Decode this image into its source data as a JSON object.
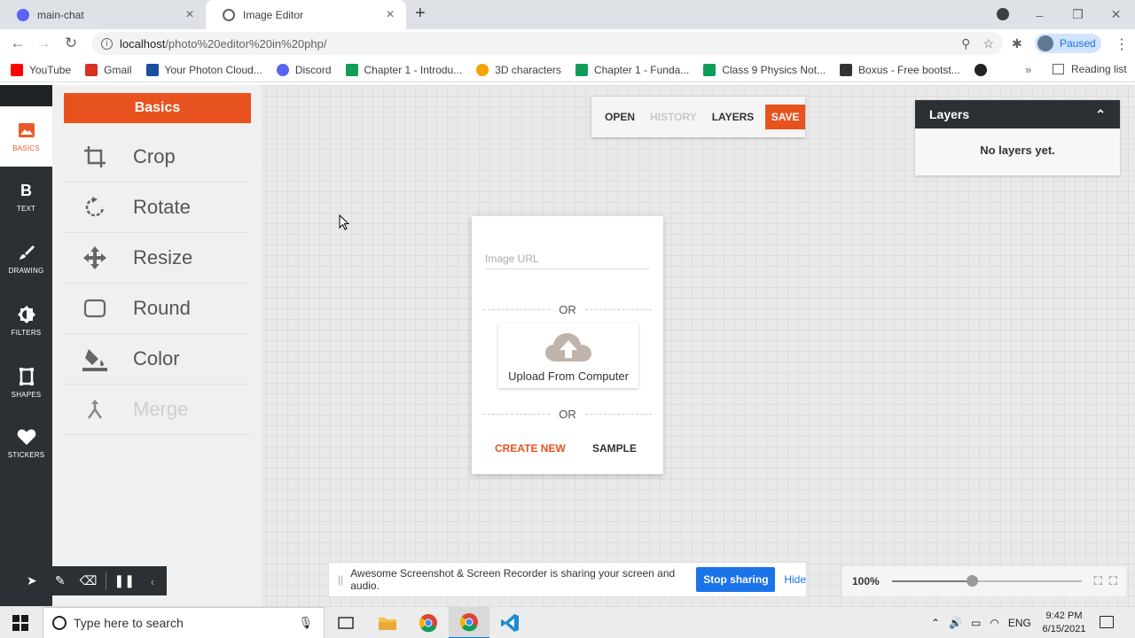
{
  "browser": {
    "tabs": [
      {
        "title": "main-chat",
        "favicon_color": "#5865f2"
      },
      {
        "title": "Image Editor",
        "favicon_color": "#5f6368"
      }
    ],
    "url_host": "localhost",
    "url_path": "/photo%20editor%20in%20php/",
    "profile_label": "Paused",
    "bookmarks": [
      {
        "label": "YouTube",
        "color": "#ff0000"
      },
      {
        "label": "Gmail",
        "color": "#d93025"
      },
      {
        "label": "Your Photon Cloud...",
        "color": "#1a4fa0"
      },
      {
        "label": "Discord",
        "color": "#5865f2"
      },
      {
        "label": "Chapter 1 - Introdu...",
        "color": "#0f9d58"
      },
      {
        "label": "3D characters",
        "color": "#f4a300"
      },
      {
        "label": "Chapter 1 - Funda...",
        "color": "#0f9d58"
      },
      {
        "label": "Class 9 Physics Not...",
        "color": "#0f9d58"
      },
      {
        "label": "Boxus - Free bootst...",
        "color": "#333333"
      }
    ],
    "reading_list": "Reading list"
  },
  "app": {
    "nav": [
      {
        "label": "BASICS",
        "icon": "image-icon"
      },
      {
        "label": "TEXT",
        "icon": "bold-icon",
        "glyph": "B"
      },
      {
        "label": "DRAWING",
        "icon": "brush-icon"
      },
      {
        "label": "FILTERS",
        "icon": "filters-icon"
      },
      {
        "label": "SHAPES",
        "icon": "shapes-icon"
      },
      {
        "label": "STICKERS",
        "icon": "heart-icon"
      }
    ],
    "panel_title": "Basics",
    "tools": [
      {
        "label": "Crop",
        "icon": "crop-icon"
      },
      {
        "label": "Rotate",
        "icon": "rotate-icon"
      },
      {
        "label": "Resize",
        "icon": "resize-icon"
      },
      {
        "label": "Round",
        "icon": "round-icon"
      },
      {
        "label": "Color",
        "icon": "fill-icon"
      },
      {
        "label": "Merge",
        "icon": "merge-icon",
        "disabled": true
      }
    ],
    "topbar": {
      "open": "OPEN",
      "history": "HISTORY",
      "layers": "LAYERS",
      "save": "SAVE"
    },
    "layers_panel": {
      "title": "Layers",
      "empty": "No layers yet."
    },
    "dialog": {
      "url_placeholder": "Image URL",
      "or1": "OR",
      "upload_label": "Upload From Computer",
      "or2": "OR",
      "create_new": "CREATE NEW",
      "sample": "SAMPLE"
    },
    "zoom": {
      "label": "100%",
      "level": 0.42
    },
    "share": {
      "message": "Awesome Screenshot & Screen Recorder is sharing your screen and audio.",
      "stop": "Stop sharing",
      "hide": "Hide"
    }
  },
  "taskbar": {
    "search_placeholder": "Type here to search",
    "lang": "ENG",
    "time": "9:42 PM",
    "date": "6/15/2021"
  }
}
